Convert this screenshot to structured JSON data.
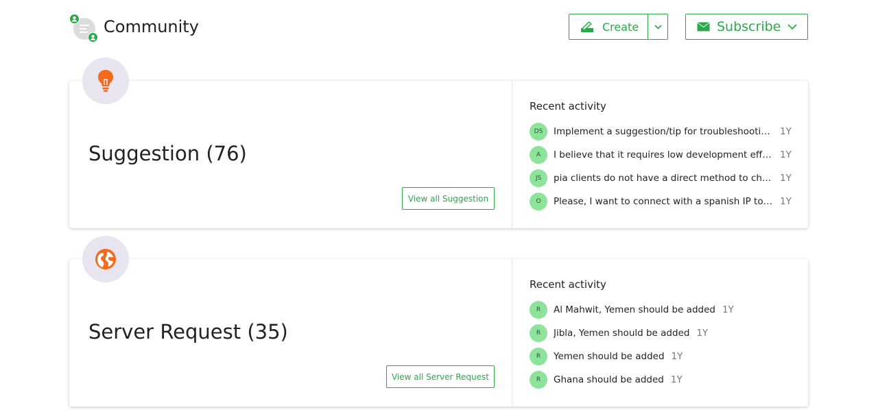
{
  "header": {
    "title": "Community",
    "create_label": "Create",
    "subscribe_label": "Subscribe"
  },
  "colors": {
    "accent": "#2aa84a",
    "icon_orange": "#f26b1d",
    "avatar_bg": "#8ee39b",
    "icon_bg": "#e9e5f0"
  },
  "categories": [
    {
      "title": "Suggestion (76)",
      "icon": "lightbulb-icon",
      "view_all_label": "View all Suggestion",
      "recent_title": "Recent activity",
      "activity": [
        {
          "initials": "DS",
          "text": "Implement a suggestion/tip for troubleshootin...",
          "age": "1Y"
        },
        {
          "initials": "A",
          "text": "I believe that it requires low development effor...",
          "age": "1Y"
        },
        {
          "initials": "JS",
          "text": "pia clients do not have a direct method to che...",
          "age": "1Y"
        },
        {
          "initials": "O",
          "text": "Please, I want to connect with a spanish IP to ...",
          "age": "1Y"
        }
      ]
    },
    {
      "title": "Server Request (35)",
      "icon": "globe-icon",
      "view_all_label": "View all Server Request",
      "recent_title": "Recent activity",
      "activity": [
        {
          "initials": "R",
          "text": "Al Mahwit, Yemen should be added",
          "age": "1Y"
        },
        {
          "initials": "R",
          "text": "Jibla, Yemen should be added",
          "age": "1Y"
        },
        {
          "initials": "R",
          "text": "Yemen should be added",
          "age": "1Y"
        },
        {
          "initials": "R",
          "text": "Ghana should be added",
          "age": "1Y"
        }
      ]
    }
  ]
}
